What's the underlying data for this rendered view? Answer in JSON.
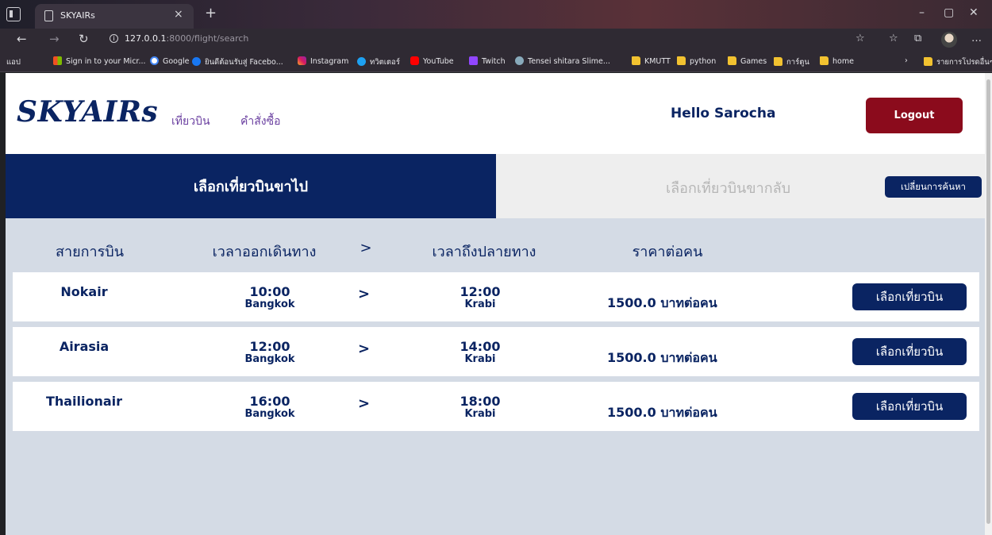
{
  "browser": {
    "tab_title": "SKYAIRs",
    "tab_close": "×",
    "new_tab": "+",
    "url_host": "127.0.0.1",
    "url_rest": ":8000/flight/search",
    "bookmarks": [
      {
        "label": "แอป",
        "icon": "page"
      },
      {
        "label": "Sign in to your Micr...",
        "icon": "ms"
      },
      {
        "label": "Google",
        "icon": "g"
      },
      {
        "label": "ยินดีต้อนรับสู่ Facebo...",
        "icon": "fb"
      },
      {
        "label": "Instagram",
        "icon": "ig"
      },
      {
        "label": "ทวิตเตอร์",
        "icon": "tw"
      },
      {
        "label": "YouTube",
        "icon": "yt"
      },
      {
        "label": "Twitch",
        "icon": "tch"
      },
      {
        "label": "Tensei shitara Slime...",
        "icon": "sl"
      },
      {
        "label": "KMUTT",
        "icon": "folder"
      },
      {
        "label": "python",
        "icon": "folder"
      },
      {
        "label": "Games",
        "icon": "folder"
      },
      {
        "label": "การ์ตูน",
        "icon": "folder"
      },
      {
        "label": "home",
        "icon": "folder"
      }
    ],
    "other_bookmarks": "รายการโปรดอื่นๆ"
  },
  "header": {
    "logo": "SKYAIRs",
    "nav": [
      "เที่ยวบิน",
      "คำสั่งซื้อ"
    ],
    "greeting": "Hello Sarocha",
    "logout_label": "Logout"
  },
  "tabs": {
    "outbound": "เลือกเที่ยวบินขาไป",
    "return": "เลือกเที่ยวบินขากลับ",
    "change_search": "เปลี่ยนการค้นหา"
  },
  "columns": [
    "สายการบิน",
    "เวลาออกเดินทาง",
    ">",
    "เวลาถึงปลายทาง",
    "ราคาต่อคน"
  ],
  "flights": [
    {
      "airline": "Nokair",
      "dep_time": "10:00",
      "dep_city": "Bangkok",
      "arrow": ">",
      "arr_time": "12:00",
      "arr_city": "Krabi",
      "price": "1500.0 บาทต่อคน",
      "select_label": "เลือกเที่ยวบิน"
    },
    {
      "airline": "Airasia",
      "dep_time": "12:00",
      "dep_city": "Bangkok",
      "arrow": ">",
      "arr_time": "14:00",
      "arr_city": "Krabi",
      "price": "1500.0 บาทต่อคน",
      "select_label": "เลือกเที่ยวบิน"
    },
    {
      "airline": "Thailionair",
      "dep_time": "16:00",
      "dep_city": "Bangkok",
      "arrow": ">",
      "arr_time": "18:00",
      "arr_city": "Krabi",
      "price": "1500.0 บาทต่อคน",
      "select_label": "เลือกเที่ยวบิน"
    }
  ],
  "colors": {
    "brand_navy": "#0a2462",
    "logout_red": "#8b0b1c",
    "page_bg": "#d4dbe5"
  }
}
